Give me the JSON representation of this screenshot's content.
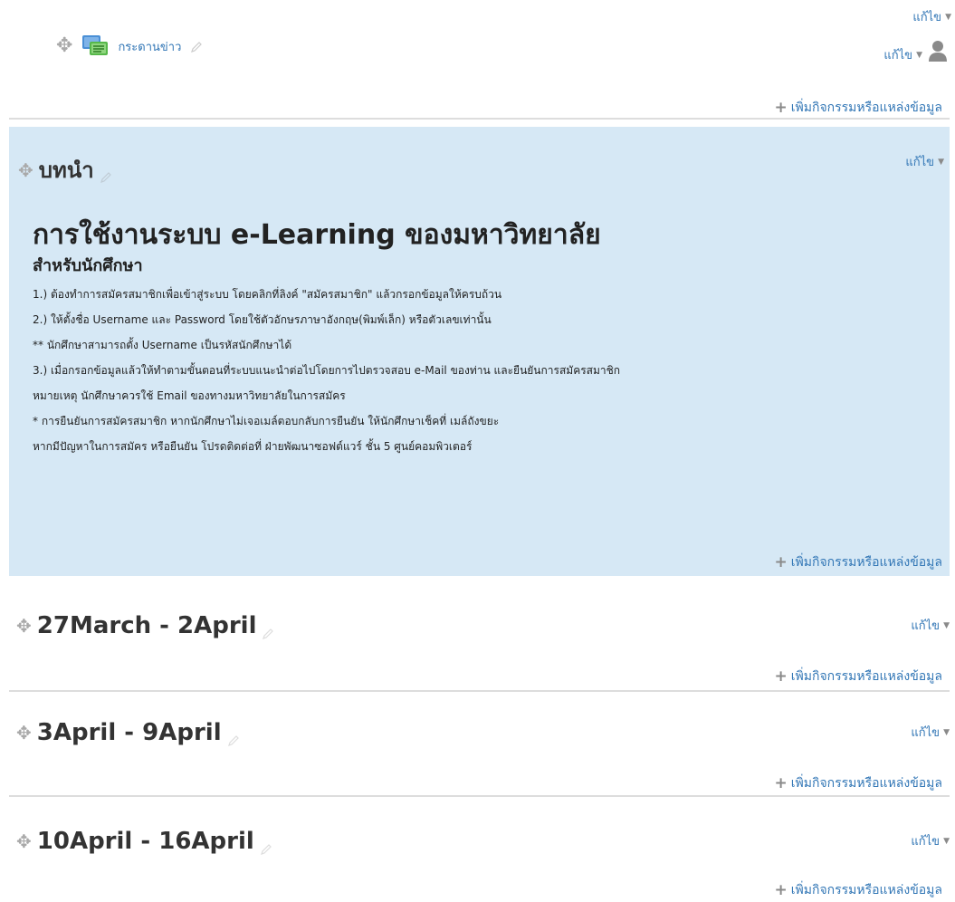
{
  "edit_label": "แก้ไข",
  "add_resource_label": "เพิ่มกิจกรรมหรือแหล่งข้อมูล",
  "top": {
    "activity": {
      "name": "กระดานข่าว",
      "icon": "forum-icon"
    }
  },
  "intro_section": {
    "title": "บทนำ",
    "heading": "การใช้งานระบบ e-Learning ของมหาวิทยาลัย",
    "subheading": "สำหรับนักศึกษา",
    "lines": [
      "1.) ต้องทำการสมัครสมาชิกเพื่อเข้าสู่ระบบ โดยคลิกที่ลิงค์ \"สมัครสมาชิก\" แล้วกรอกข้อมูลให้ครบถ้วน",
      "2.) ให้ตั้งชื่อ Username และ Password โดยใช้ตัวอักษรภาษาอังกฤษ(พิมพ์เล็ก) หรือตัวเลขเท่านั้น",
      "** นักศึกษาสามารถตั้ง Username เป็นรหัสนักศึกษาได้",
      "3.) เมื่อกรอกข้อมูลแล้วให้ทำตามขั้นตอนที่ระบบแนะนำต่อไปโดยการไปตรวจสอบ e-Mail ของท่าน และยืนยันการสมัครสมาชิก",
      "หมายเหตุ นักศึกษาควรใช้ Email ของทางมหาวิทยาลัยในการสมัคร",
      "* การยืนยันการสมัครสมาชิก หากนักศึกษาไม่เจอเมล์ตอบกลับการยืนยัน ให้นักศึกษาเช็คที่ เมล์ถังขยะ",
      "หากมีปัญหาในการสมัคร หรือยืนยัน โปรดติดต่อที่ ฝ่ายพัฒนาซอฟต์แวร์ ชั้น 5 ศูนย์คอมพิวเตอร์"
    ]
  },
  "weeks": [
    {
      "title": "27March - 2April"
    },
    {
      "title": "3April - 9April"
    },
    {
      "title": "10April - 16April"
    }
  ],
  "colors": {
    "link": "#3377b6",
    "intro_bg": "#d6e8f5",
    "divider": "#dddddd"
  }
}
